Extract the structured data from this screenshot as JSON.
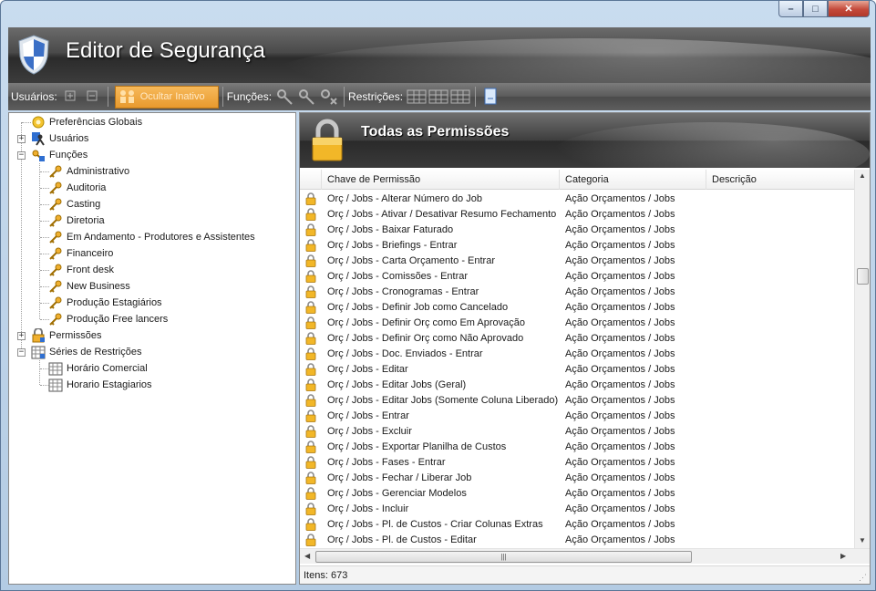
{
  "window": {
    "title": "Editor de Segurança"
  },
  "toolbar": {
    "users_label": "Usuários:",
    "hide_inactive_label": "Ocultar Inativo",
    "functions_label": "Funções:",
    "restrictions_label": "Restrições:"
  },
  "tree": {
    "global_prefs": "Preferências Globais",
    "users": "Usuários",
    "functions": "Funções",
    "function_items": [
      "Administrativo",
      "Auditoria",
      "Casting",
      "Diretoria",
      "Em Andamento - Produtores e Assistentes",
      "Financeiro",
      "Front desk",
      "New Business",
      "Produção Estagiários",
      "Produção Free lancers"
    ],
    "permissions": "Permissões",
    "restriction_series": "Séries de Restrições",
    "restriction_items": [
      "Horário Comercial",
      "Horario Estagiarios"
    ]
  },
  "panel": {
    "title": "Todas as Permissões"
  },
  "grid": {
    "columns": [
      "Chave de Permissão",
      "Categoria",
      "Descrição"
    ],
    "rows": [
      [
        "Orç / Jobs - Alterar Número do Job",
        "Ação Orçamentos / Jobs"
      ],
      [
        "Orç / Jobs - Ativar / Desativar Resumo Fechamento",
        "Ação Orçamentos / Jobs"
      ],
      [
        "Orç / Jobs - Baixar Faturado",
        "Ação Orçamentos / Jobs"
      ],
      [
        "Orç / Jobs - Briefings - Entrar",
        "Ação Orçamentos / Jobs"
      ],
      [
        "Orç / Jobs - Carta Orçamento - Entrar",
        "Ação Orçamentos / Jobs"
      ],
      [
        "Orç / Jobs - Comissões - Entrar",
        "Ação Orçamentos / Jobs"
      ],
      [
        "Orç / Jobs - Cronogramas - Entrar",
        "Ação Orçamentos / Jobs"
      ],
      [
        "Orç / Jobs - Definir Job como Cancelado",
        "Ação Orçamentos / Jobs"
      ],
      [
        "Orç / Jobs - Definir Orç como Em Aprovação",
        "Ação Orçamentos / Jobs"
      ],
      [
        "Orç / Jobs - Definir Orç como Não Aprovado",
        "Ação Orçamentos / Jobs"
      ],
      [
        "Orç / Jobs - Doc. Enviados - Entrar",
        "Ação Orçamentos / Jobs"
      ],
      [
        "Orç / Jobs - Editar",
        "Ação Orçamentos / Jobs"
      ],
      [
        "Orç / Jobs - Editar Jobs (Geral)",
        "Ação Orçamentos / Jobs"
      ],
      [
        "Orç / Jobs - Editar Jobs (Somente Coluna Liberado)",
        "Ação Orçamentos / Jobs"
      ],
      [
        "Orç / Jobs - Entrar",
        "Ação Orçamentos / Jobs"
      ],
      [
        "Orç / Jobs - Excluir",
        "Ação Orçamentos / Jobs"
      ],
      [
        "Orç / Jobs - Exportar Planilha de Custos",
        "Ação Orçamentos / Jobs"
      ],
      [
        "Orç / Jobs - Fases - Entrar",
        "Ação Orçamentos / Jobs"
      ],
      [
        "Orç / Jobs - Fechar / Liberar Job",
        "Ação Orçamentos / Jobs"
      ],
      [
        "Orç / Jobs - Gerenciar Modelos",
        "Ação Orçamentos / Jobs"
      ],
      [
        "Orç / Jobs - Incluir",
        "Ação Orçamentos / Jobs"
      ],
      [
        "Orç / Jobs - Pl. de Custos - Criar Colunas Extras",
        "Ação Orçamentos / Jobs"
      ],
      [
        "Orç / Jobs - Pl. de Custos - Editar",
        "Ação Orçamentos / Jobs"
      ]
    ]
  },
  "status": {
    "items": "Itens: 673"
  },
  "icons": {
    "row": "padlock-icon",
    "header": "shield-icon"
  },
  "colors": {
    "accent": "#f0a23a",
    "banner": "#3c3c3c"
  }
}
